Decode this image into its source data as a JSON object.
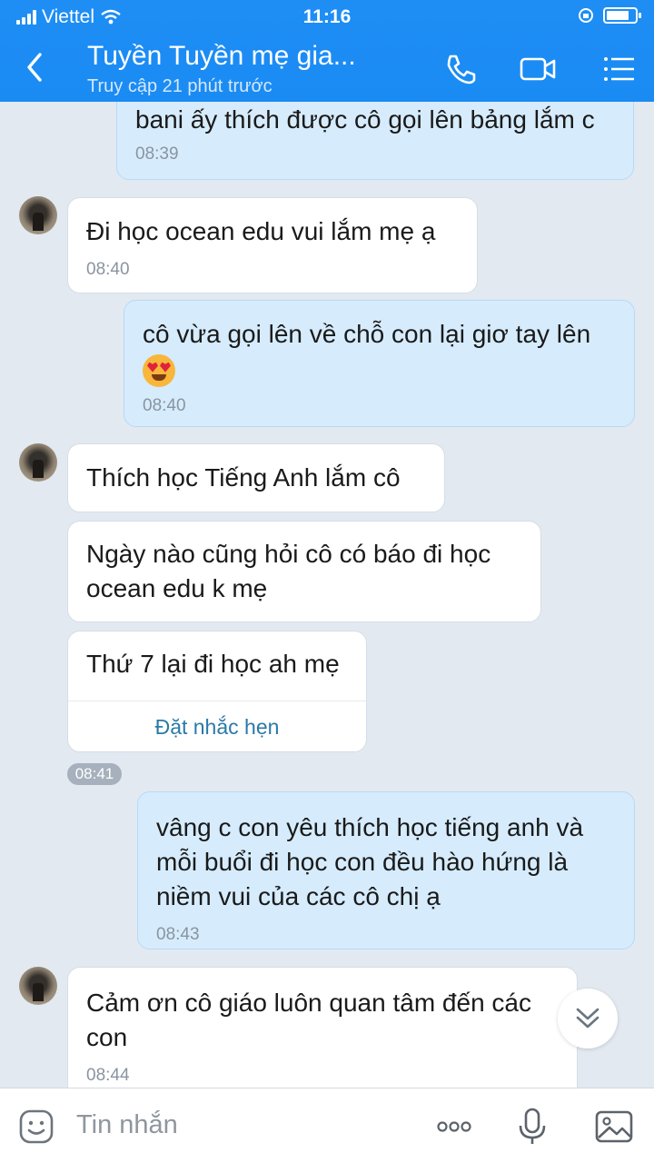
{
  "status_bar": {
    "carrier": "Viettel",
    "time": "11:16",
    "battery_level": 0.8
  },
  "header": {
    "title": "Tuyền Tuyền mẹ gia...",
    "subtitle": "Truy cập 21 phút trước",
    "icons": [
      "back-icon",
      "phone-icon",
      "video-call-icon",
      "menu-icon"
    ]
  },
  "messages": [
    {
      "direction": "out",
      "text": "bani ấy thích được cô gọi lên bảng lắm c",
      "time": "08:39"
    },
    {
      "direction": "in",
      "text": "Đi học ocean edu vui lắm mẹ ạ",
      "time": "08:40"
    },
    {
      "direction": "out",
      "text": "cô vừa gọi lên về chỗ con lại giơ tay lên",
      "emoji": "heart-eyes",
      "time": "08:40"
    },
    {
      "direction": "in",
      "text": "Thích học Tiếng Anh lắm cô"
    },
    {
      "direction": "in",
      "text_lines": [
        "Ngày nào cũng hỏi cô có báo đi học",
        "ocean edu k mẹ"
      ]
    },
    {
      "direction": "in",
      "text": "Thứ 7 lại đi học ah mẹ",
      "action": "Đặt nhắc hẹn"
    },
    {
      "direction": "out",
      "text_lines": [
        "vâng c con yêu thích học tiếng anh và",
        "mỗi buổi đi học con đều hào hứng là",
        "niềm vui của các cô chị ạ"
      ],
      "time": "08:43"
    },
    {
      "direction": "in",
      "text_lines": [
        "Cảm ơn cô giáo luôn quan tâm đến các",
        "con"
      ],
      "time": "08:44"
    }
  ],
  "group_time": "08:41",
  "input": {
    "placeholder": "Tin nhắn",
    "icons": [
      "sticker-icon",
      "more-icon",
      "microphone-icon",
      "image-icon"
    ]
  }
}
